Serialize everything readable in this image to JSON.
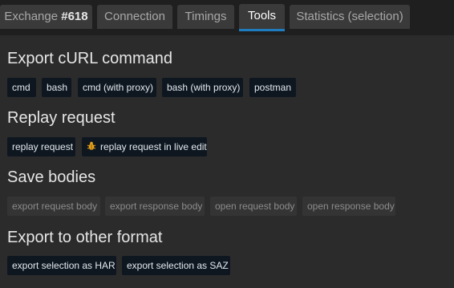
{
  "tabs": [
    {
      "label": "Exchange ",
      "num": "#618",
      "active": false
    },
    {
      "label": "Connection",
      "active": false
    },
    {
      "label": "Timings",
      "active": false
    },
    {
      "label": "Tools",
      "active": true
    },
    {
      "label": "Statistics (selection)",
      "active": false
    }
  ],
  "sections": {
    "curl": {
      "title": "Export cURL command",
      "buttons": [
        "cmd",
        "bash",
        "cmd (with proxy)",
        "bash (with proxy)",
        "postman"
      ]
    },
    "replay": {
      "title": "Replay request",
      "buttons": [
        "replay request",
        "replay request in live edit"
      ],
      "live_edit_icon": "bug-icon"
    },
    "save": {
      "title": "Save bodies",
      "buttons": [
        "export request body",
        "export response body",
        "open request body",
        "open response body"
      ]
    },
    "export": {
      "title": "Export to other format",
      "buttons": [
        "export selection as HAR",
        "export selection as SAZ"
      ]
    }
  },
  "colors": {
    "accent": "#1f7cbf",
    "button_bg": "#0e1720",
    "disabled_bg": "#343435"
  }
}
